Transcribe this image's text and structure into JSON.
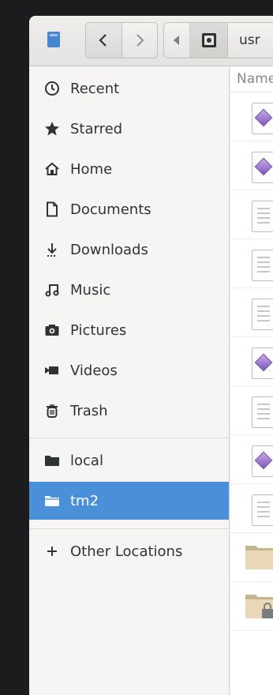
{
  "toolbar": {
    "path_current": "usr"
  },
  "sidebar": {
    "items": [
      {
        "label": "Recent",
        "icon": "clock-icon"
      },
      {
        "label": "Starred",
        "icon": "star-icon"
      },
      {
        "label": "Home",
        "icon": "home-icon"
      },
      {
        "label": "Documents",
        "icon": "document-icon"
      },
      {
        "label": "Downloads",
        "icon": "download-icon"
      },
      {
        "label": "Music",
        "icon": "music-icon"
      },
      {
        "label": "Pictures",
        "icon": "camera-icon"
      },
      {
        "label": "Videos",
        "icon": "video-icon"
      },
      {
        "label": "Trash",
        "icon": "trash-icon"
      }
    ],
    "drives": [
      {
        "label": "local",
        "icon": "folder-icon"
      },
      {
        "label": "tm2",
        "icon": "folder-icon",
        "selected": true
      }
    ],
    "other": {
      "label": "Other Locations",
      "icon": "plus-icon"
    }
  },
  "filelist": {
    "column_header": "Name",
    "rows": [
      "ui-file",
      "ui-file",
      "text-file",
      "text-file",
      "text-file",
      "ui-file",
      "text-file",
      "ui-file",
      "text-file",
      "folder",
      "folder-locked"
    ]
  },
  "colors": {
    "selection": "#4a90d9",
    "sidebar_bg": "#f6f5f4",
    "headerbar_bg": "#e8e7e5"
  }
}
